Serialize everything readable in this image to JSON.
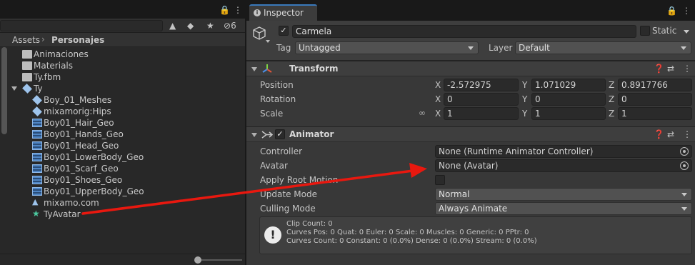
{
  "project_panel": {
    "toolbar_count": "6",
    "breadcrumb": [
      "Assets",
      "Personajes"
    ],
    "tree": [
      {
        "label": "Animaciones",
        "icon": "folder-icon",
        "indent": 1
      },
      {
        "label": "Materials",
        "icon": "folder-icon",
        "indent": 1
      },
      {
        "label": "Ty.fbm",
        "icon": "folder-icon",
        "indent": 1
      },
      {
        "label": "Ty",
        "icon": "model-prefab-icon",
        "indent": 0,
        "expanded": true
      },
      {
        "label": "Boy_01_Meshes",
        "icon": "model-prefab-icon",
        "indent": 2
      },
      {
        "label": "mixamorig:Hips",
        "icon": "model-prefab-icon",
        "indent": 2
      },
      {
        "label": "Boy01_Hair_Geo",
        "icon": "mesh-icon",
        "indent": 2
      },
      {
        "label": "Boy01_Hands_Geo",
        "icon": "mesh-icon",
        "indent": 2
      },
      {
        "label": "Boy01_Head_Geo",
        "icon": "mesh-icon",
        "indent": 2
      },
      {
        "label": "Boy01_LowerBody_Geo",
        "icon": "mesh-icon",
        "indent": 2
      },
      {
        "label": "Boy01_Scarf_Geo",
        "icon": "mesh-icon",
        "indent": 2
      },
      {
        "label": "Boy01_Shoes_Geo",
        "icon": "mesh-icon",
        "indent": 2
      },
      {
        "label": "Boy01_UpperBody_Geo",
        "icon": "mesh-icon",
        "indent": 2
      },
      {
        "label": "mixamo.com",
        "icon": "animation-clip-icon",
        "indent": 2
      },
      {
        "label": "TyAvatar",
        "icon": "avatar-icon",
        "indent": 2
      }
    ]
  },
  "inspector": {
    "tab_label": "Inspector",
    "object_name": "Carmela",
    "static_label": "Static",
    "tag_label": "Tag",
    "tag_value": "Untagged",
    "layer_label": "Layer",
    "layer_value": "Default",
    "transform": {
      "title": "Transform",
      "position_label": "Position",
      "rotation_label": "Rotation",
      "scale_label": "Scale",
      "axis_x": "X",
      "axis_y": "Y",
      "axis_z": "Z",
      "position": {
        "x": "-2.572975",
        "y": "1.071029",
        "z": "0.8917766"
      },
      "rotation": {
        "x": "0",
        "y": "0",
        "z": "0"
      },
      "scale": {
        "x": "1",
        "y": "1",
        "z": "1"
      }
    },
    "animator": {
      "title": "Animator",
      "controller_label": "Controller",
      "controller_value": "None (Runtime Animator Controller)",
      "avatar_label": "Avatar",
      "avatar_value": "None (Avatar)",
      "apply_root_motion_label": "Apply Root Motion",
      "update_mode_label": "Update Mode",
      "update_mode_value": "Normal",
      "culling_mode_label": "Culling Mode",
      "culling_mode_value": "Always Animate",
      "info": [
        "Clip Count: 0",
        "Curves Pos: 0 Quat: 0 Euler: 0 Scale: 0 Muscles: 0 Generic: 0 PPtr: 0",
        "Curves Count: 0 Constant: 0 (0.0%) Dense: 0 (0.0%) Stream: 0 (0.0%)"
      ]
    }
  },
  "colors": {
    "annotation_arrow": "#e8180f",
    "tab_accent": "#3a79bb"
  }
}
